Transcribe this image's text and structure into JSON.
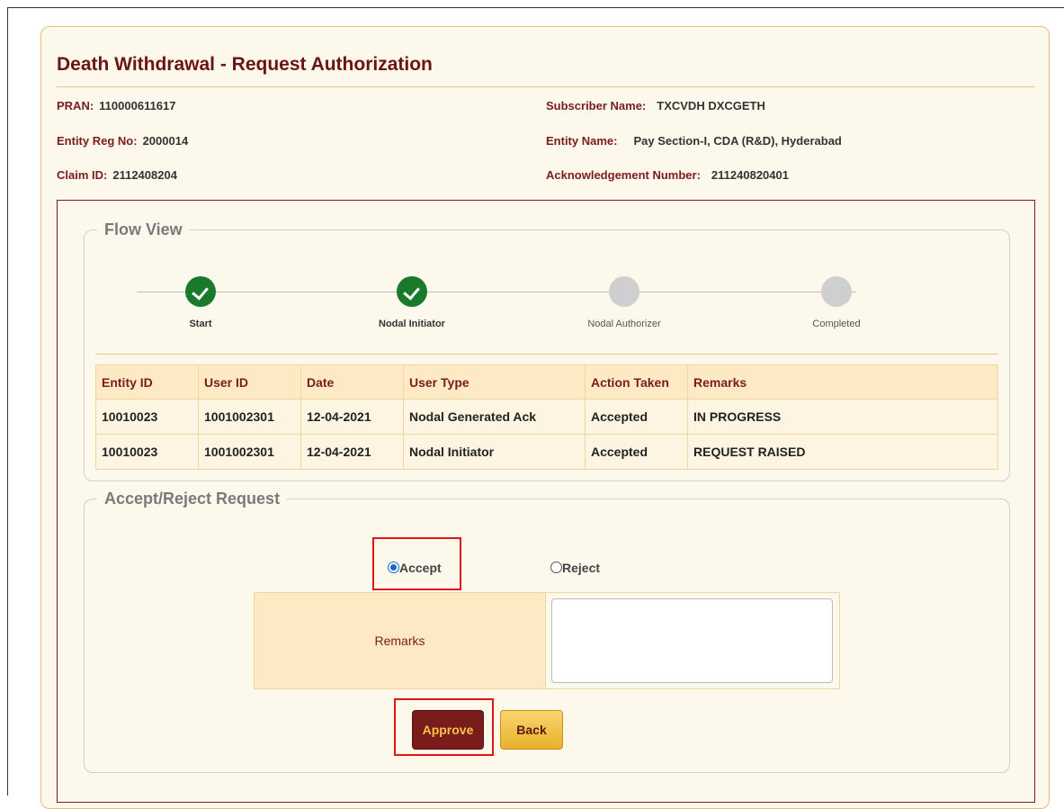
{
  "page": {
    "title": "Death Withdrawal - Request Authorization"
  },
  "info": {
    "pran_label": "PRAN:",
    "pran_value": "110000611617",
    "entity_reg_label": "Entity Reg No:",
    "entity_reg_value": "2000014",
    "claim_label": "Claim ID:",
    "claim_value": "2112408204",
    "subscriber_label": "Subscriber Name:",
    "subscriber_value": "TXCVDH DXCGETH",
    "entity_name_label": "Entity Name:",
    "entity_name_value": "Pay Section-I, CDA (R&D), Hyderabad",
    "ack_label": "Acknowledgement Number:",
    "ack_value": "211240820401"
  },
  "flow": {
    "legend": "Flow View",
    "steps": [
      {
        "label": "Start",
        "status": "done"
      },
      {
        "label": "Nodal Initiator",
        "status": "done"
      },
      {
        "label": "Nodal Authorizer",
        "status": "pending"
      },
      {
        "label": "Completed",
        "status": "pending"
      }
    ],
    "table": {
      "headers": [
        "Entity ID",
        "User ID",
        "Date",
        "User Type",
        "Action Taken",
        "Remarks"
      ],
      "rows": [
        [
          "10010023",
          "1001002301",
          "12-04-2021",
          "Nodal Generated Ack",
          "Accepted",
          "IN PROGRESS"
        ],
        [
          "10010023",
          "1001002301",
          "12-04-2021",
          "Nodal Initiator",
          "Accepted",
          "REQUEST RAISED"
        ]
      ]
    }
  },
  "decision": {
    "legend": "Accept/Reject Request",
    "accept_label": "Accept",
    "reject_label": "Reject",
    "selected": "Accept",
    "remarks_label": "Remarks",
    "remarks_value": "",
    "approve_label": "Approve",
    "back_label": "Back"
  },
  "colors": {
    "accent": "#7a1c1c",
    "done_step": "#1a7a2c",
    "pending_step": "#cfcfcf",
    "highlight": "#e01515"
  }
}
